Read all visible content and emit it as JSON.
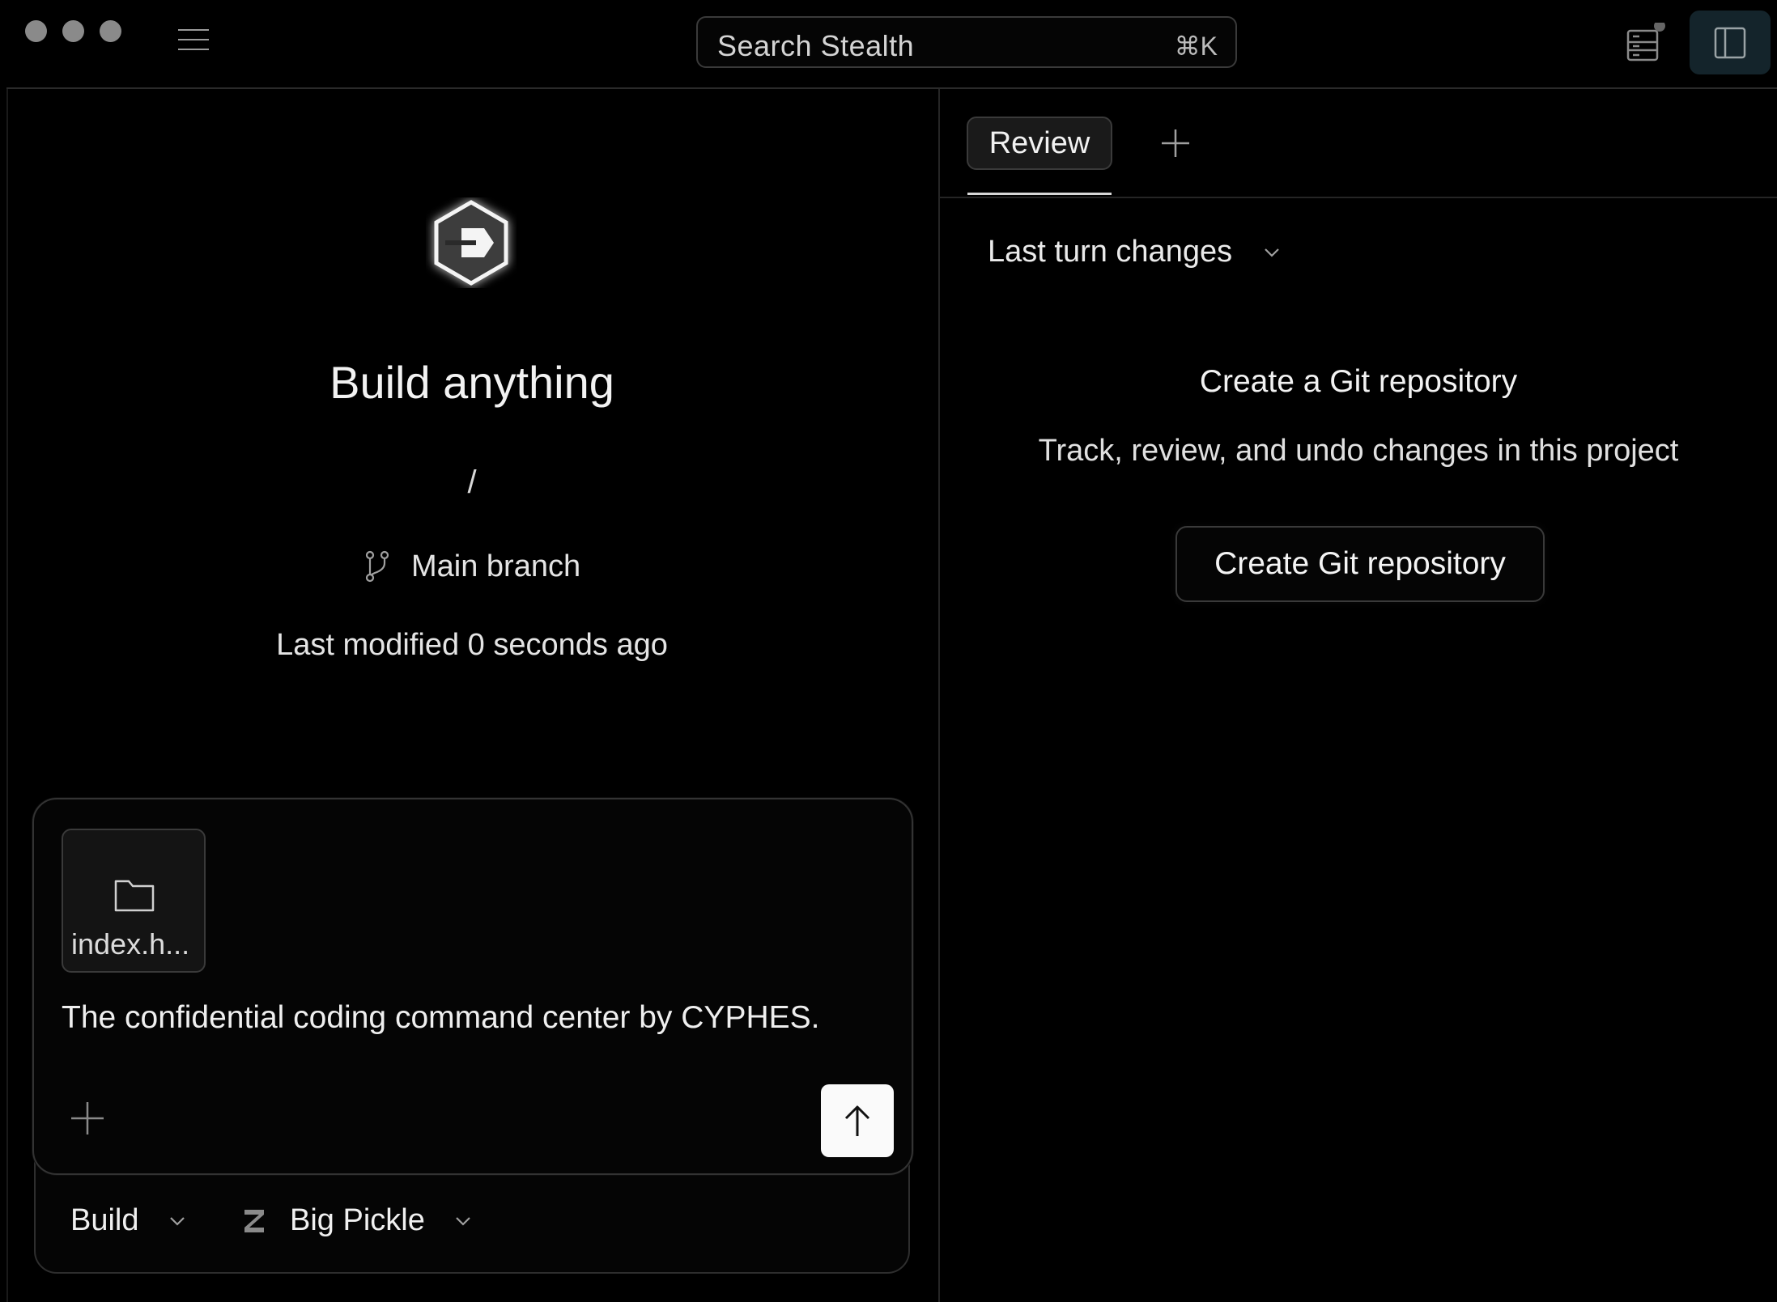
{
  "titlebar": {
    "search_placeholder": "Search Stealth",
    "search_shortcut": "⌘K"
  },
  "left": {
    "title": "Build anything",
    "path": "/",
    "branch": "Main branch",
    "modified": "Last modified 0 seconds ago"
  },
  "composer": {
    "attachment_name": "index.h...",
    "text": "The confidential coding command center by CYPHES.",
    "mode_label": "Build",
    "model_label": "Big Pickle"
  },
  "right": {
    "tab_review": "Review",
    "changes_label": "Last turn changes",
    "git_title": "Create a Git repository",
    "git_desc": "Track, review, and undo changes in this project",
    "git_button": "Create Git repository"
  },
  "colors": {
    "background": "#000000",
    "sidebar_toggle_active": "#14242b",
    "send_button": "#fafafa"
  },
  "icons": {
    "menu": "hamburger-menu-icon",
    "panel": "sidebar-panel-icon",
    "layout": "layout-icon",
    "logo": "hexagon-arrow-logo",
    "branch": "git-branch-icon",
    "folder": "folder-icon",
    "plus": "plus-icon",
    "send": "arrow-up-icon",
    "chevron": "chevron-down-icon",
    "model": "model-z-icon"
  }
}
